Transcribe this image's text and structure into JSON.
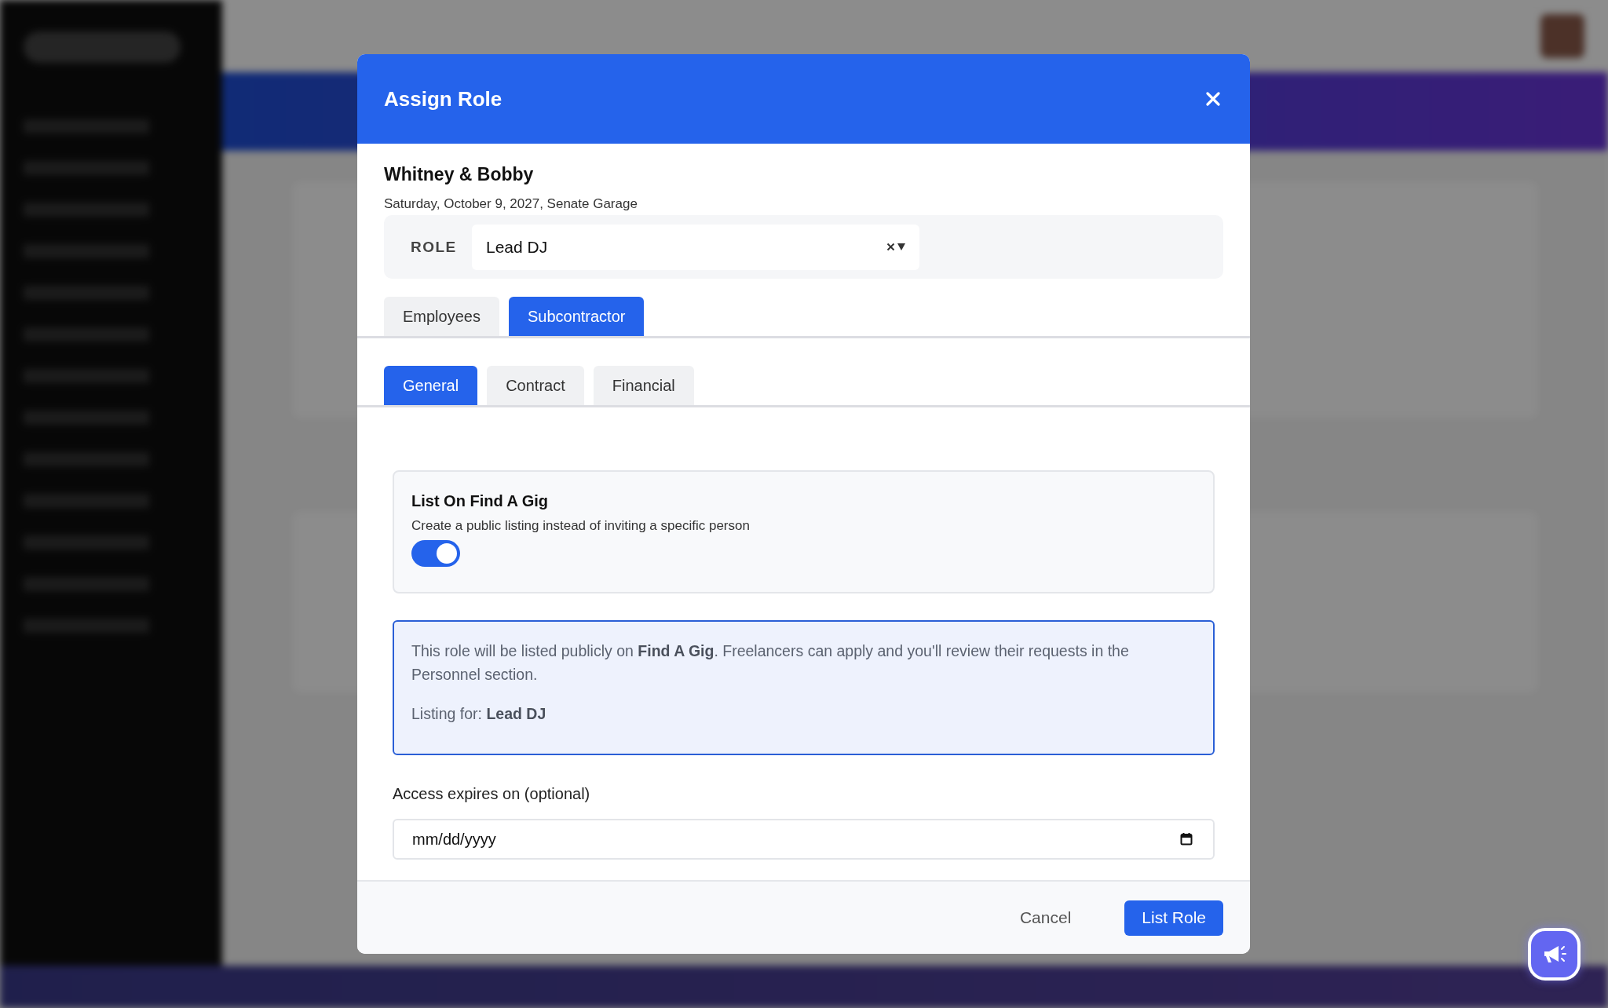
{
  "dialog": {
    "title": "Assign Role",
    "event": {
      "name": "Whitney & Bobby",
      "details": "Saturday, October 9, 2027, Senate Garage"
    },
    "role": {
      "label": "ROLE",
      "value": "Lead DJ"
    },
    "tabs": [
      {
        "label": "Employees",
        "selected": false
      },
      {
        "label": "Subcontractor",
        "selected": true
      }
    ],
    "subtabs": [
      {
        "label": "General",
        "selected": true
      },
      {
        "label": "Contract",
        "selected": false
      },
      {
        "label": "Financial",
        "selected": false
      }
    ],
    "find_a_gig": {
      "title": "List On Find A Gig",
      "description": "Create a public listing instead of inviting a specific person",
      "on": true
    },
    "notice": {
      "paragraphs": [
        "This role will be listed publicly on **Find A Gig**. Freelancers can apply and you'll review their requests in the Personnel section.",
        "Listing for: **Lead DJ**"
      ]
    },
    "expiry": {
      "label": "Access expires on (optional)",
      "placeholder": "mm/dd/yyyy"
    },
    "buttons": [
      {
        "label": "Cancel",
        "kind": "secondary"
      },
      {
        "label": "List Role",
        "kind": "primary"
      }
    ]
  }
}
